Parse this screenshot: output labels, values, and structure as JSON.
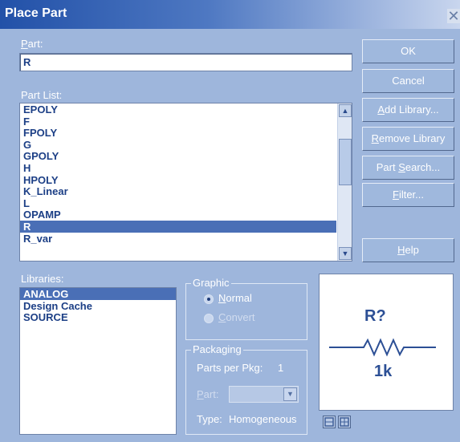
{
  "window": {
    "title": "Place Part",
    "close_glyph": "✕"
  },
  "part": {
    "label_u": "P",
    "label_rest": "art:",
    "value": "R"
  },
  "part_list": {
    "label": "Part List:",
    "items": [
      "EPOLY",
      "F",
      "FPOLY",
      "G",
      "GPOLY",
      "H",
      "HPOLY",
      "K_Linear",
      "L",
      "OPAMP",
      "R",
      "R_var"
    ],
    "selected_index": 10
  },
  "buttons": {
    "ok": "OK",
    "cancel": "Cancel",
    "add_library_u": "A",
    "add_library_rest": "dd Library...",
    "remove_library_u": "R",
    "remove_library_rest": "emove Library",
    "part_search_pre": "Part ",
    "part_search_u": "S",
    "part_search_rest": "earch...",
    "filter_u": "F",
    "filter_rest": "ilter...",
    "help_u": "H",
    "help_rest": "elp"
  },
  "libraries": {
    "label": "Libraries:",
    "items": [
      "ANALOG",
      "Design Cache",
      "SOURCE"
    ],
    "selected_index": 0
  },
  "graphic": {
    "title": "Graphic",
    "normal_u": "N",
    "normal_rest": "ormal",
    "convert_u": "C",
    "convert_rest": "onvert",
    "selected": "normal"
  },
  "packaging": {
    "title": "Packaging",
    "parts_per_pkg_label": "Parts per Pkg:",
    "parts_per_pkg_value": "1",
    "part_label_u": "P",
    "part_label_rest": "art:",
    "type_label": "Type:",
    "type_value": "Homogeneous"
  },
  "preview": {
    "ref": "R?",
    "value": "1k",
    "symbol": "resistor-symbol"
  },
  "icons": {
    "scroll_up": "up-arrow-icon",
    "scroll_down": "down-arrow-icon",
    "dropdown": "dropdown-arrow-icon"
  },
  "colors": {
    "dialog_bg": "#9eb6dc",
    "title_bar_start": "#2251a8",
    "list_text": "#1c3f86",
    "selection": "#4a6fb6",
    "preview_ink": "#2c4f95"
  }
}
